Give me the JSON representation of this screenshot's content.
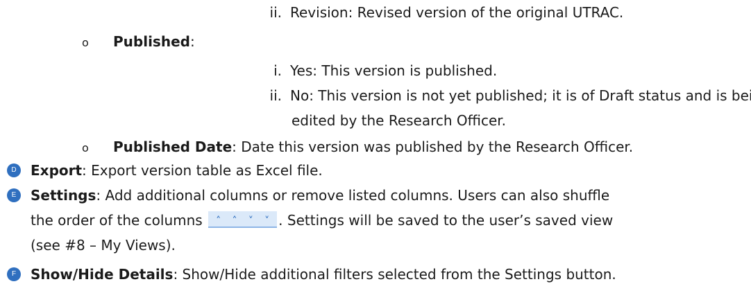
{
  "published_values": {
    "revision": {
      "num": "ii.",
      "text": "Revision: Revised version of the original UTRAC."
    }
  },
  "published": {
    "bullet": "o",
    "label": "Published",
    "colon": ":",
    "items": [
      {
        "num": "i.",
        "text": "Yes: This version is published."
      },
      {
        "num": "ii.",
        "text": "No: This version is not yet published; it is of Draft status and is being"
      },
      {
        "continuation": "edited by the Research Officer."
      }
    ]
  },
  "published_date": {
    "bullet": "o",
    "label": "Published Date",
    "text": ": Date this version was published by the Research Officer."
  },
  "export": {
    "badge": "D",
    "label": "Export",
    "text": ": Export version table as Excel file."
  },
  "settings": {
    "badge": "E",
    "label": "Settings",
    "line1": ": Add additional columns or remove listed columns. Users can also shuffle",
    "line2_before": "the order of the columns",
    "line2_after": ". Settings will be saved to the user’s saved view",
    "line3": "(see #8 – My Views).",
    "order_icons": [
      "double-chevron-up-icon",
      "chevron-up-icon",
      "chevron-down-icon",
      "double-chevron-down-icon"
    ]
  },
  "show_hide": {
    "badge": "F",
    "label": "Show/Hide Details",
    "text": ": Show/Hide additional filters selected from the Settings button."
  },
  "colors": {
    "badge": "#2f6fbf",
    "chevron_bg": "#dbe9f9"
  }
}
